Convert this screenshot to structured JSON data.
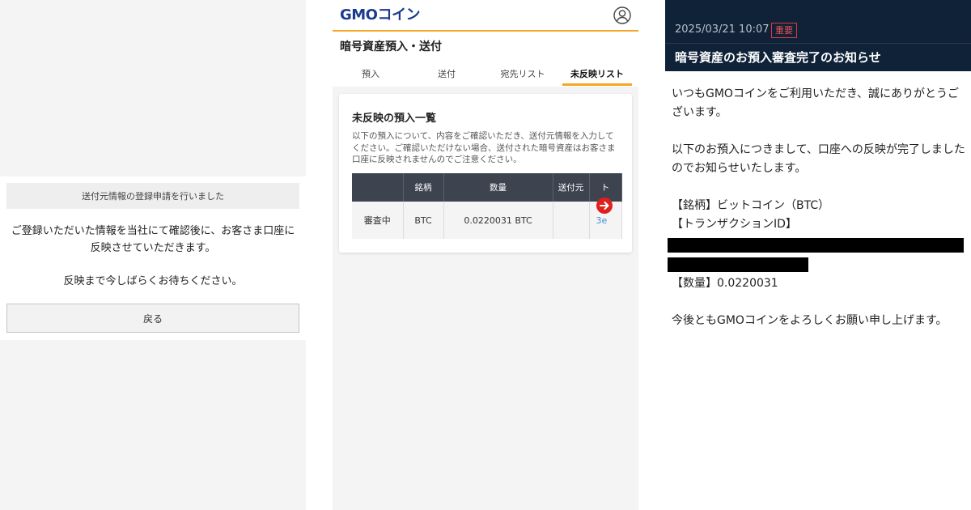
{
  "left_panel": {
    "notice": "送付元情報の登録申請を行いました",
    "message1": "ご登録いただいた情報を当社にて確認後に、お客さま口座に反映させていただきます。",
    "message2": "反映まで今しばらくお待ちください。",
    "back_button": "戻る"
  },
  "middle_panel": {
    "logo": "GMOコイン",
    "page_title": "暗号資産預入・送付",
    "tabs": [
      "預入",
      "送付",
      "宛先リスト",
      "未反映リスト"
    ],
    "active_tab": "未反映リスト",
    "card_title": "未反映の預入一覧",
    "card_description": "以下の預入について、内容をご確認いただき、送付元情報を入力してください。ご確認いただけない場合、送付された暗号資産はお客さま口座に反映されませんのでご注意ください。",
    "table": {
      "headers": [
        "",
        "銘柄",
        "数量",
        "送付元",
        "ト"
      ],
      "rows": [
        [
          "審査中",
          "BTC",
          "0.0220031 BTC",
          "",
          "3e"
        ]
      ]
    },
    "colors": {
      "accent": "#f5a623",
      "brand": "#1a3c8f",
      "arrow": "#e0201f"
    }
  },
  "right_panel": {
    "date": "2025/03/21 10:07",
    "badge": "重要",
    "title": "暗号資産のお預入審査完了のお知らせ",
    "paragraph1": "いつもGMOコインをご利用いただき、誠にありがとうございます。",
    "paragraph2": "以下のお預入につきまして、口座への反映が完了しましたのでお知らせいたします。",
    "brand_line": "【銘柄】ビットコイン（BTC）",
    "txid_label": "【トランザクションID】",
    "amount_line": "【数量】0.0220031",
    "closing": "今後ともGMOコインをよろしくお願い申し上げます。"
  }
}
